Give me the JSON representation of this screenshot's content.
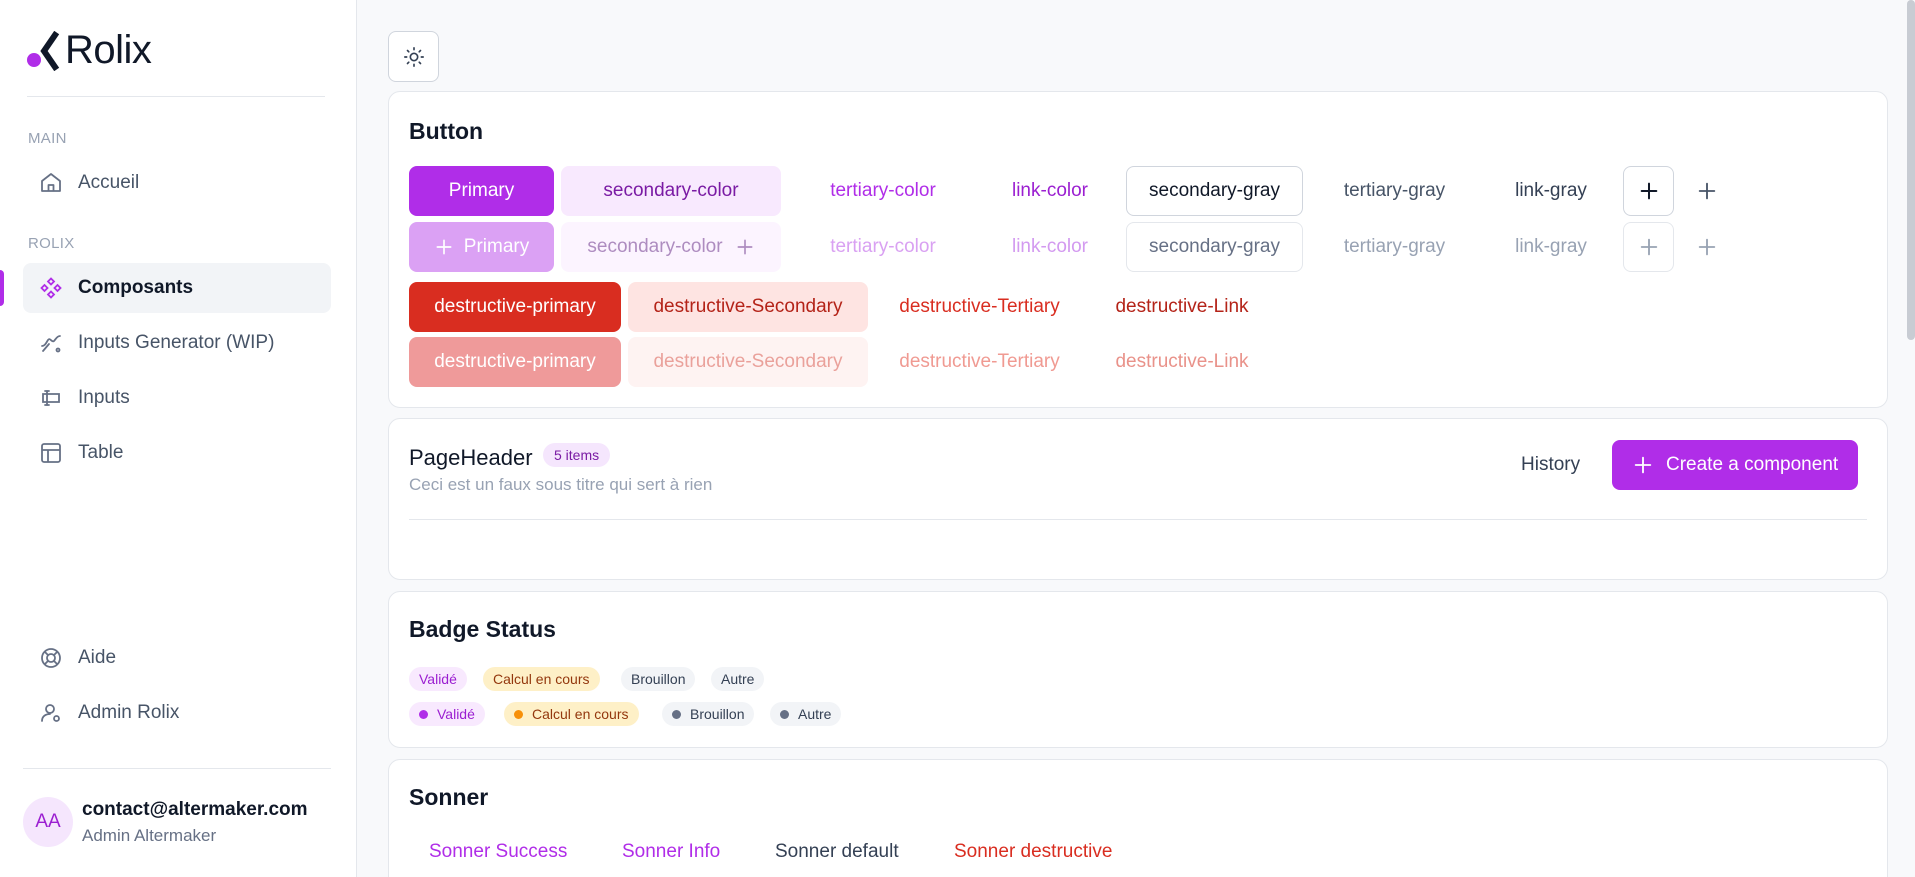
{
  "brand": {
    "name": "Rolix",
    "accent": "#b02de8"
  },
  "sidebar": {
    "sections": [
      {
        "title": "MAIN"
      },
      {
        "title": "ROLIX"
      }
    ],
    "items": [
      {
        "label": "Accueil",
        "icon": "home-icon"
      },
      {
        "label": "Composants",
        "icon": "components-icon",
        "active": true
      },
      {
        "label": "Inputs Generator (WIP)",
        "icon": "generator-icon"
      },
      {
        "label": "Inputs",
        "icon": "input-icon"
      },
      {
        "label": "Table",
        "icon": "table-icon"
      }
    ],
    "footer_items": [
      {
        "label": "Aide",
        "icon": "lifebuoy-icon"
      },
      {
        "label": "Admin Rolix",
        "icon": "user-settings-icon"
      }
    ],
    "user": {
      "initials": "AA",
      "email": "contact@altermaker.com",
      "role": "Admin Altermaker"
    }
  },
  "button_card": {
    "title": "Button",
    "row1": [
      "Primary",
      "secondary-color",
      "tertiary-color",
      "link-color",
      "secondary-gray",
      "tertiary-gray",
      "link-gray"
    ],
    "row2": [
      "Primary",
      "secondary-color",
      "tertiary-color",
      "link-color",
      "secondary-gray",
      "tertiary-gray",
      "link-gray"
    ],
    "row3": [
      "destructive-primary",
      "destructive-Secondary",
      "destructive-Tertiary",
      "destructive-Link"
    ],
    "row4": [
      "destructive-primary",
      "destructive-Secondary",
      "destructive-Tertiary",
      "destructive-Link"
    ]
  },
  "page_header_card": {
    "title": "PageHeader",
    "count_badge": "5 items",
    "subtitle": "Ceci est un faux sous titre qui sert à rien",
    "history_label": "History",
    "create_label": "Create a component"
  },
  "badge_card": {
    "title": "Badge Status",
    "plain": [
      "Validé",
      "Calcul en cours",
      "Brouillon",
      "Autre"
    ],
    "dotted": [
      "Validé",
      "Calcul en cours",
      "Brouillon",
      "Autre"
    ],
    "dot_colors": [
      "#b02de8",
      "#f79009",
      "#667085",
      "#667085"
    ]
  },
  "sonner_card": {
    "title": "Sonner",
    "buttons": [
      "Sonner Success",
      "Sonner Info",
      "Sonner default",
      "Sonner destructive"
    ]
  }
}
